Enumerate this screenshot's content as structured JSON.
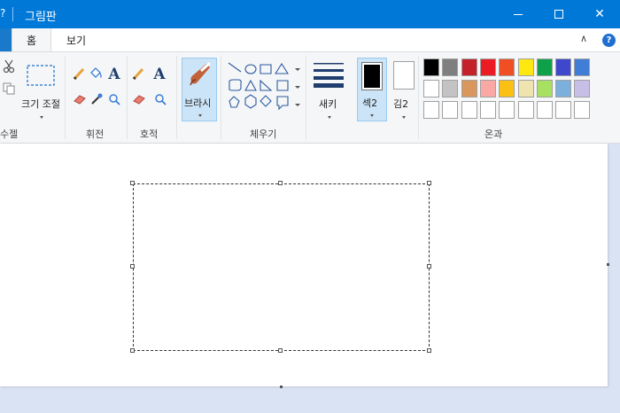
{
  "window": {
    "title": "그림판",
    "quick_access_glyph": "?",
    "controls": {
      "close_glyph": "✕"
    }
  },
  "tabs": {
    "home": "홈",
    "view": "보기",
    "collapse_glyph": "∧",
    "help_glyph": "?"
  },
  "ribbon": {
    "groups": {
      "image": "수젤",
      "tools": "휘전",
      "shapes_effects": "호적",
      "shapes": "체우기",
      "colors": "온과"
    },
    "select": {
      "resize_label": "크기 조절"
    },
    "brush": {
      "label": "브라시"
    },
    "size": {
      "label": "새키"
    },
    "color2": {
      "label": "섹2"
    },
    "color1": {
      "label": "김2"
    }
  },
  "palette": {
    "row1": [
      "#000000",
      "#7f7f7f",
      "#c3222b",
      "#ec1c24",
      "#f04f23",
      "#ffe811",
      "#0ea14a",
      "#3f48cc",
      "#3f7dd6"
    ],
    "row2": [
      "#ffffff",
      "#c3c3c3",
      "#d9975e",
      "#f9a8a3",
      "#fcc015",
      "#efe4b0",
      "#a8e061",
      "#7cb0dc",
      "#c8bfe7"
    ],
    "row3": [
      "#ffffff",
      "#ffffff",
      "#ffffff",
      "#ffffff",
      "#ffffff",
      "#ffffff",
      "#ffffff",
      "#ffffff",
      "#ffffff"
    ]
  },
  "colors": {
    "title_bar": "#0078d7",
    "ribbon_bg": "#f5f6f7",
    "canvas_bg": "#ffffff",
    "workspace_bg": "#dae3f3",
    "selected_button": "#cce4f7",
    "color2_value": "#000000",
    "color1_value": "#ffffff"
  }
}
